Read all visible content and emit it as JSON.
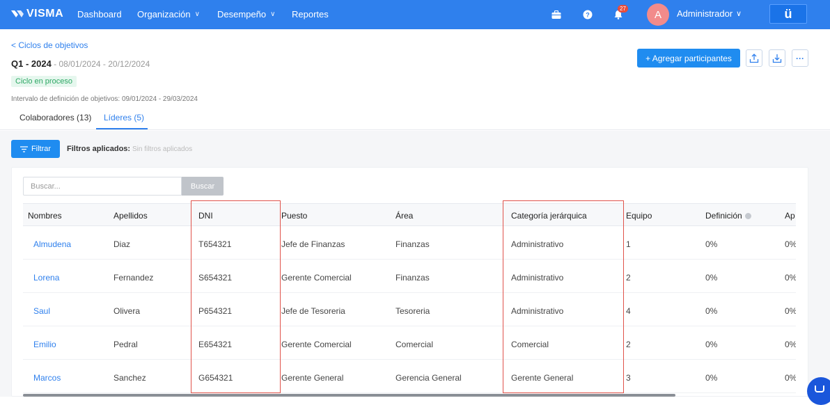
{
  "nav": {
    "logo": "VISMA",
    "items": [
      {
        "label": "Dashboard"
      },
      {
        "label": "Organización"
      },
      {
        "label": "Desempeño"
      },
      {
        "label": "Reportes"
      }
    ],
    "notifications_count": "27",
    "avatar_letter": "A",
    "user_name": "Administrador",
    "app_button": "ü",
    "colors": {
      "nav_bg": "#2f80ed",
      "accent": "#1f8cf0"
    }
  },
  "header": {
    "back_link": "< Ciclos de objetivos",
    "cycle_name": "Q1 - 2024",
    "cycle_dates": " - 08/01/2024 - 20/12/2024",
    "status": "Ciclo en proceso",
    "interval": "Intervalo de definición de objetivos: 09/01/2024 - 29/03/2024",
    "add_participants": "+ Agregar participantes",
    "more": "···"
  },
  "tabs": [
    {
      "label": "Colaboradores (13)",
      "active": false
    },
    {
      "label": "Líderes (5)",
      "active": true
    }
  ],
  "filters": {
    "button": "Filtrar",
    "applied_label": "Filtros aplicados:",
    "applied_value": "Sin filtros aplicados"
  },
  "search": {
    "placeholder": "Buscar...",
    "button": "Buscar"
  },
  "table": {
    "columns": [
      "Nombres",
      "Apellidos",
      "DNI",
      "Puesto",
      "Área",
      "Categoría jerárquica",
      "Equipo",
      "Definición",
      "Ap"
    ],
    "rows": [
      {
        "nombre": "Almudena",
        "apellido": "Diaz",
        "dni": "T654321",
        "puesto": "Jefe de Finanzas",
        "area": "Finanzas",
        "categoria": "Administrativo",
        "equipo": "1",
        "definicion": "0%",
        "ap": "0%"
      },
      {
        "nombre": "Lorena",
        "apellido": "Fernandez",
        "dni": "S654321",
        "puesto": "Gerente Comercial",
        "area": "Finanzas",
        "categoria": "Administrativo",
        "equipo": "2",
        "definicion": "0%",
        "ap": "0%"
      },
      {
        "nombre": "Saul",
        "apellido": "Olivera",
        "dni": "P654321",
        "puesto": "Jefe de Tesoreria",
        "area": "Tesoreria",
        "categoria": "Administrativo",
        "equipo": "4",
        "definicion": "0%",
        "ap": "0%"
      },
      {
        "nombre": "Emilio",
        "apellido": "Pedral",
        "dni": "E654321",
        "puesto": "Gerente Comercial",
        "area": "Comercial",
        "categoria": "Comercial",
        "equipo": "2",
        "definicion": "0%",
        "ap": "0%"
      },
      {
        "nombre": "Marcos",
        "apellido": "Sanchez",
        "dni": "G654321",
        "puesto": "Gerente General",
        "area": "Gerencia General",
        "categoria": "Gerente General",
        "equipo": "3",
        "definicion": "0%",
        "ap": "0%"
      }
    ]
  }
}
